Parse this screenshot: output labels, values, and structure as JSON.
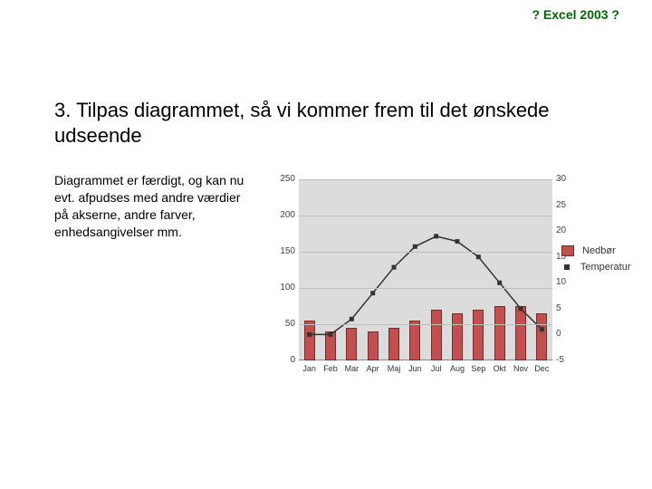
{
  "header": {
    "text": "? Excel 2003 ?"
  },
  "title": "3. Tilpas diagrammet, så vi kommer frem til det ønskede udseende",
  "paragraph": "Diagrammet er færdigt, og kan nu evt. afpudses med andre værdier på akserne, andre farver, enhedsangivelser mm.",
  "legend": {
    "nedbor": "Nedbør",
    "temperatur": "Temperatur"
  },
  "chart_data": {
    "type": "bar+line",
    "categories": [
      "Jan",
      "Feb",
      "Mar",
      "Apr",
      "Maj",
      "Jun",
      "Jul",
      "Aug",
      "Sep",
      "Okt",
      "Nov",
      "Dec"
    ],
    "series": [
      {
        "name": "Nedbør",
        "axis": "left",
        "type": "bar",
        "values": [
          55,
          40,
          45,
          40,
          45,
          55,
          70,
          65,
          70,
          75,
          75,
          65
        ]
      },
      {
        "name": "Temperatur",
        "axis": "right",
        "type": "line",
        "values": [
          0,
          0,
          3,
          8,
          13,
          17,
          19,
          18,
          15,
          10,
          5,
          1
        ]
      }
    ],
    "left_axis": {
      "min": 0,
      "max": 250,
      "ticks": [
        0,
        50,
        100,
        150,
        200,
        250
      ]
    },
    "right_axis": {
      "min": -5,
      "max": 30,
      "ticks": [
        -5,
        0,
        5,
        10,
        15,
        20,
        25,
        30
      ]
    },
    "xlabel": "",
    "ylabel": ""
  }
}
